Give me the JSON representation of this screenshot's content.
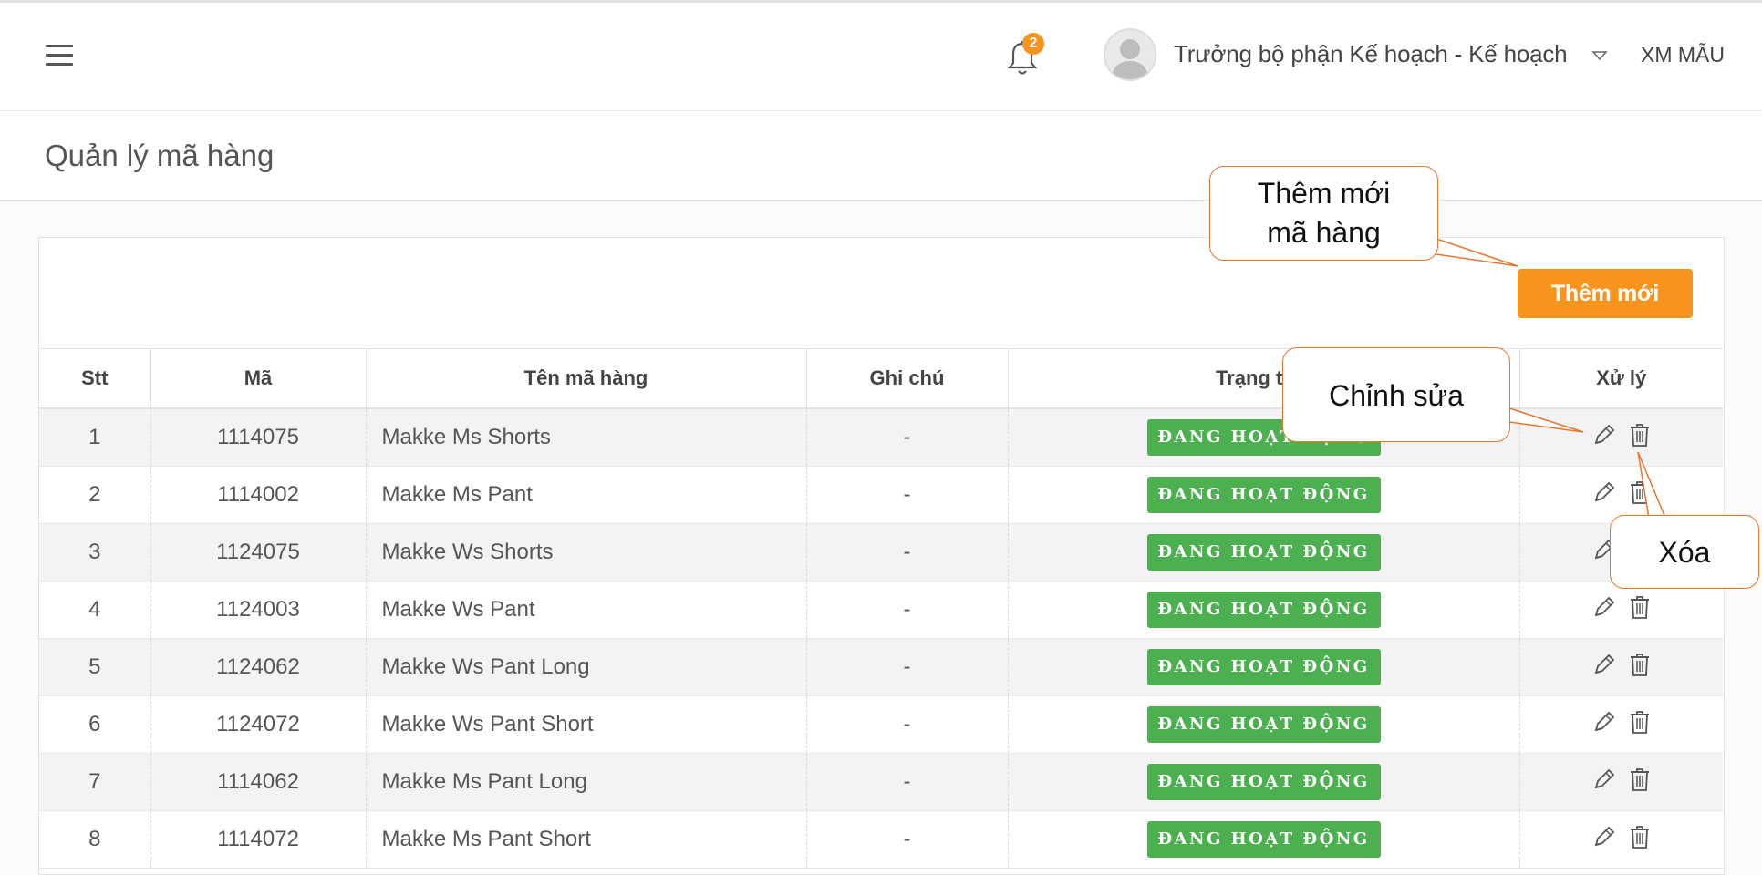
{
  "header": {
    "notification_count": "2",
    "user_name": "Trưởng bộ phận Kế hoạch - Kế hoạch",
    "company": "XM MẪU"
  },
  "page": {
    "title": "Quản lý mã hàng",
    "add_button": "Thêm mới"
  },
  "table": {
    "columns": [
      "Stt",
      "Mã",
      "Tên mã hàng",
      "Ghi chú",
      "Trạng thái",
      "Xử lý"
    ],
    "rows": [
      {
        "stt": "1",
        "code": "1114075",
        "name": "Makke Ms Shorts",
        "note": "-",
        "status": "ĐANG HOẠT ĐỘNG"
      },
      {
        "stt": "2",
        "code": "1114002",
        "name": "Makke Ms Pant",
        "note": "-",
        "status": "ĐANG HOẠT ĐỘNG"
      },
      {
        "stt": "3",
        "code": "1124075",
        "name": "Makke Ws Shorts",
        "note": "-",
        "status": "ĐANG HOẠT ĐỘNG"
      },
      {
        "stt": "4",
        "code": "1124003",
        "name": "Makke Ws Pant",
        "note": "-",
        "status": "ĐANG HOẠT ĐỘNG"
      },
      {
        "stt": "5",
        "code": "1124062",
        "name": "Makke Ws Pant Long",
        "note": "-",
        "status": "ĐANG HOẠT ĐỘNG"
      },
      {
        "stt": "6",
        "code": "1124072",
        "name": "Makke Ws Pant Short",
        "note": "-",
        "status": "ĐANG HOẠT ĐỘNG"
      },
      {
        "stt": "7",
        "code": "1114062",
        "name": "Makke Ms Pant Long",
        "note": "-",
        "status": "ĐANG HOẠT ĐỘNG"
      },
      {
        "stt": "8",
        "code": "1114072",
        "name": "Makke Ms Pant Short",
        "note": "-",
        "status": "ĐANG HOẠT ĐỘNG"
      }
    ]
  },
  "annotations": {
    "add_new": "Thêm mới\nmã hàng",
    "edit": "Chỉnh sửa",
    "delete": "Xóa"
  },
  "colors": {
    "accent_orange": "#f7941d",
    "status_green": "#4caf50",
    "callout_border": "#e8772e"
  },
  "icons": [
    "hamburger-menu-icon",
    "bell-icon",
    "user-avatar-icon",
    "caret-down-icon",
    "pencil-icon",
    "trash-icon"
  ]
}
